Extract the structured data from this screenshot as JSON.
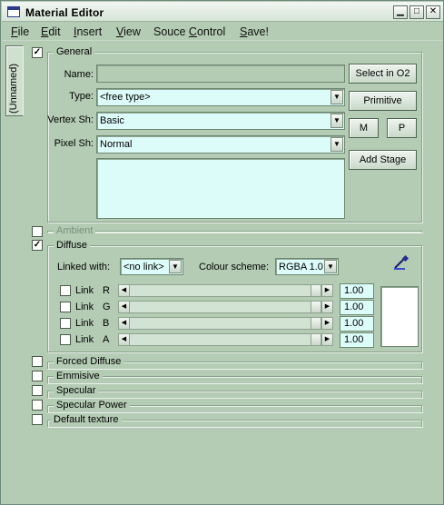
{
  "window": {
    "title": "Material  Editor",
    "min": "▁",
    "max": "□",
    "close": "✕"
  },
  "menu": [
    {
      "label": "File",
      "u": "F",
      "rest": "ile"
    },
    {
      "label": "Edit",
      "u": "E",
      "rest": "dit"
    },
    {
      "label": "Insert",
      "u": "I",
      "rest": "nsert"
    },
    {
      "label": "View",
      "u": "V",
      "rest": "iew"
    },
    {
      "label": "Souce Control",
      "pre": "Souce ",
      "u": "C",
      "rest": "ontrol"
    },
    {
      "label": "Save!",
      "u": "S",
      "rest": "ave!"
    }
  ],
  "sidetab": "(Unnamed)",
  "general": {
    "title": "General",
    "checked": true,
    "name_label": "Name:",
    "name_value": "",
    "type_label": "Type:",
    "type_value": "<free type>",
    "vertex_label": "Vertex Sh:",
    "vertex_value": "Basic",
    "pixel_label": "Pixel Sh:",
    "pixel_value": "Normal",
    "buttons": {
      "select": "Select in O2",
      "primitive": "Primitive",
      "m": "M",
      "p": "P",
      "add_stage": "Add Stage"
    }
  },
  "ambient": {
    "title": "Ambient",
    "checked": false
  },
  "diffuse": {
    "title": "Diffuse",
    "checked": true,
    "linked_label": "Linked with:",
    "linked_value": "<no link>",
    "colour_label": "Colour scheme:",
    "colour_value": "RGBA 1.0",
    "link_label": "Link",
    "channels": [
      {
        "name": "R",
        "value": "1.00",
        "level": 1.0
      },
      {
        "name": "G",
        "value": "1.00",
        "level": 1.0
      },
      {
        "name": "B",
        "value": "1.00",
        "level": 1.0
      },
      {
        "name": "A",
        "value": "1.00",
        "level": 1.0
      }
    ],
    "swatch_color": "#ffffff"
  },
  "sections": [
    {
      "title": "Forced Diffuse",
      "checked": false
    },
    {
      "title": "Emmisive",
      "checked": false
    },
    {
      "title": "Specular",
      "checked": false
    },
    {
      "title": "Specular Power",
      "checked": false
    },
    {
      "title": "Default texture",
      "checked": false
    }
  ],
  "colors": {
    "bg": "#b4cbb4",
    "field": "#dcfcfa"
  },
  "icons": {
    "picker": "eyedropper-icon"
  }
}
